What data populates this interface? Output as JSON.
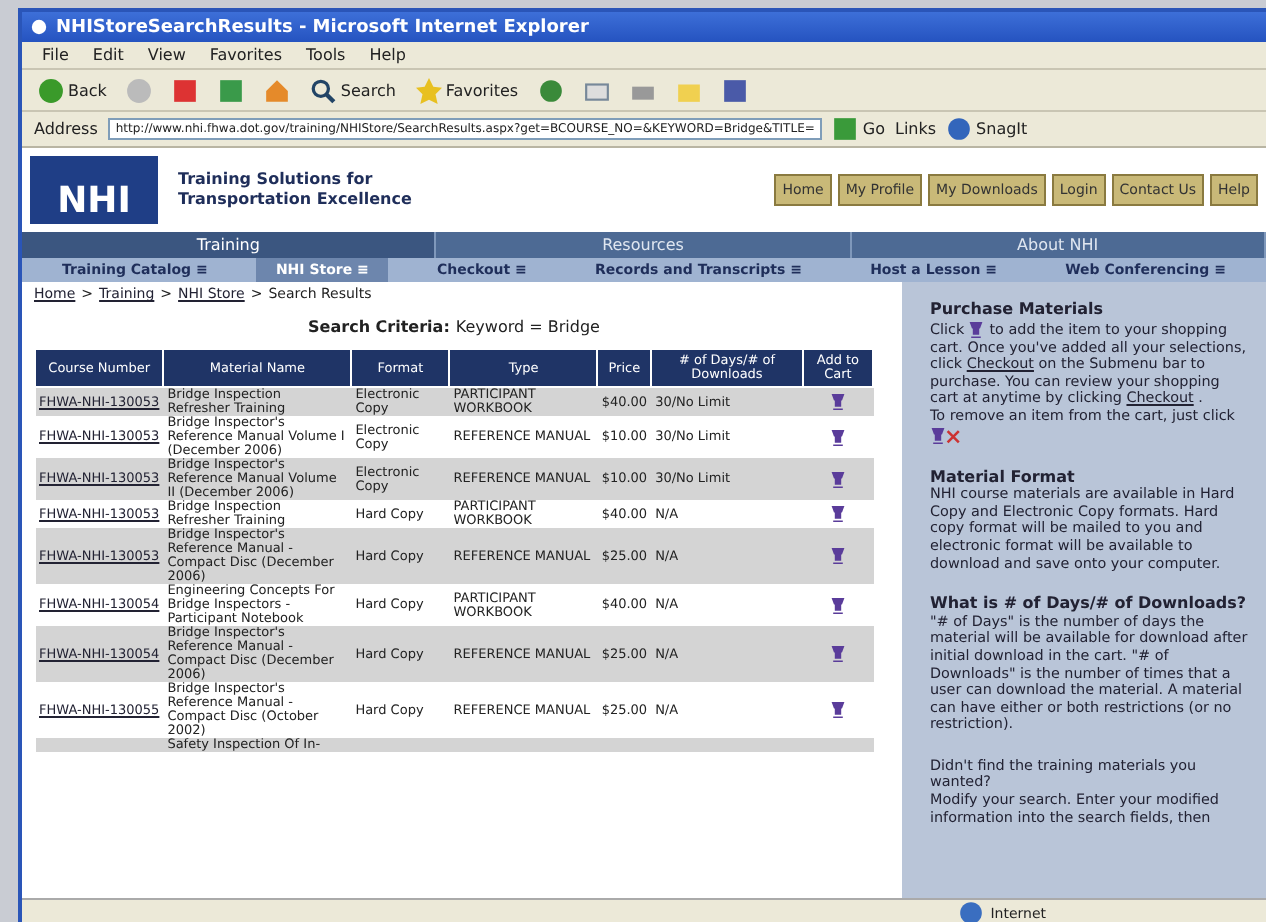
{
  "window": {
    "title": "NHIStoreSearchResults - Microsoft Internet Explorer"
  },
  "menu": [
    "File",
    "Edit",
    "View",
    "Favorites",
    "Tools",
    "Help"
  ],
  "toolbar": {
    "back": "Back",
    "search": "Search",
    "favorites": "Favorites"
  },
  "address_bar": {
    "label": "Address",
    "value": "http://www.nhi.fhwa.dot.gov/training/NHIStore/SearchResults.aspx?get=BCOURSE_NO=&KEYWORD=Bridge&TITLE=",
    "go": "Go",
    "links": "Links",
    "snagit": "SnagIt"
  },
  "site_header": {
    "tagline_1": "Training Solutions for",
    "tagline_2": "Transportation Excellence",
    "logo": "NHI",
    "buttons": [
      "Home",
      "My Profile",
      "My Downloads",
      "Login",
      "Contact Us",
      "Help"
    ]
  },
  "main_tabs": [
    {
      "label": "Training",
      "selected": true
    },
    {
      "label": "Resources",
      "selected": false
    },
    {
      "label": "About NHI",
      "selected": false
    }
  ],
  "sub_tabs": [
    {
      "label": "Training Catalog ≡",
      "selected": false
    },
    {
      "label": "NHI Store ≡",
      "selected": true
    },
    {
      "label": "Checkout ≡",
      "selected": false
    },
    {
      "label": "Records and Transcripts ≡",
      "selected": false
    },
    {
      "label": "Host a Lesson ≡",
      "selected": false
    },
    {
      "label": "Web Conferencing ≡",
      "selected": false
    }
  ],
  "breadcrumb": [
    {
      "label": "Home",
      "kind": "link"
    },
    {
      "label": ">",
      "kind": "separator"
    },
    {
      "label": "Training",
      "kind": "link"
    },
    {
      "label": ">",
      "kind": "separator"
    },
    {
      "label": "NHI Store",
      "kind": "link"
    },
    {
      "label": ">",
      "kind": "separator"
    },
    {
      "label": "Search Results",
      "kind": "current"
    }
  ],
  "search_criteria": {
    "label": "Search Criteria:",
    "value": "Keyword = Bridge"
  },
  "table": {
    "columns": [
      "Course Number",
      "Material Name",
      "Format",
      "Type",
      "Price",
      "# of Days/# of Downloads",
      "Add to Cart"
    ],
    "rows": [
      {
        "course": "FHWA-NHI-130053",
        "material": "Bridge Inspection Refresher Training",
        "format": "Electronic Copy",
        "type": "PARTICIPANT WORKBOOK",
        "price": "$40.00",
        "limit": "30/No Limit"
      },
      {
        "course": "FHWA-NHI-130053",
        "material": "Bridge Inspector's Reference Manual Volume I (December 2006)",
        "format": "Electronic Copy",
        "type": "REFERENCE MANUAL",
        "price": "$10.00",
        "limit": "30/No Limit"
      },
      {
        "course": "FHWA-NHI-130053",
        "material": "Bridge Inspector's Reference Manual Volume II (December 2006)",
        "format": "Electronic Copy",
        "type": "REFERENCE MANUAL",
        "price": "$10.00",
        "limit": "30/No Limit"
      },
      {
        "course": "FHWA-NHI-130053",
        "material": "Bridge Inspection Refresher Training",
        "format": "Hard Copy",
        "type": "PARTICIPANT WORKBOOK",
        "price": "$40.00",
        "limit": "N/A"
      },
      {
        "course": "FHWA-NHI-130053",
        "material": "Bridge Inspector's Reference Manual - Compact Disc (December 2006)",
        "format": "Hard Copy",
        "type": "REFERENCE MANUAL",
        "price": "$25.00",
        "limit": "N/A"
      },
      {
        "course": "FHWA-NHI-130054",
        "material": "Engineering Concepts For Bridge Inspectors - Participant Notebook",
        "format": "Hard Copy",
        "type": "PARTICIPANT WORKBOOK",
        "price": "$40.00",
        "limit": "N/A"
      },
      {
        "course": "FHWA-NHI-130054",
        "material": "Bridge Inspector's Reference Manual - Compact Disc (December 2006)",
        "format": "Hard Copy",
        "type": "REFERENCE MANUAL",
        "price": "$25.00",
        "limit": "N/A"
      },
      {
        "course": "FHWA-NHI-130055",
        "material": "Bridge Inspector's Reference Manual - Compact Disc (October 2002)",
        "format": "Hard Copy",
        "type": "REFERENCE MANUAL",
        "price": "$25.00",
        "limit": "N/A"
      },
      {
        "material": "Safety Inspection Of In-"
      }
    ]
  },
  "sidebar": {
    "sections": [
      {
        "heading": "Purchase Materials",
        "paragraphs": [
          [
            {
              "kind": "text",
              "text": "Click"
            },
            {
              "kind": "cart"
            },
            {
              "kind": "text",
              "text": "to add the item to your shopping cart. Once you've added all your selections, click"
            },
            {
              "kind": "link",
              "text": "Checkout"
            },
            {
              "kind": "text",
              "text": "on the Submenu bar to purchase. You can review your shopping cart at anytime by clicking"
            },
            {
              "kind": "link",
              "text": "Checkout"
            },
            {
              "kind": "text",
              "text": "."
            }
          ],
          [
            {
              "kind": "text",
              "text": "To remove an item from the cart, just click"
            },
            {
              "kind": "remove"
            }
          ]
        ]
      },
      {
        "heading": "Material Format",
        "paragraphs": [
          [
            {
              "kind": "text",
              "text": "NHI course materials are available in Hard Copy and Electronic Copy formats. Hard copy format will be mailed to you and electronic format will be available to download and save onto your computer."
            }
          ]
        ]
      },
      {
        "heading": "What is # of Days/# of Downloads?",
        "paragraphs": [
          [
            {
              "kind": "text",
              "text": "\"# of Days\" is the number of days the material will be available for download after initial download in the cart. \"# of Downloads\" is the number of times that a user can download the material. A material can have either or both restrictions (or no restriction)."
            }
          ]
        ]
      },
      {
        "paragraphs": [
          [
            {
              "kind": "text",
              "text": "Didn't find the training materials you wanted?"
            }
          ],
          [
            {
              "kind": "text",
              "text": "Modify your search. Enter your modified information into the search fields, then"
            }
          ]
        ]
      }
    ]
  },
  "status_bar": {
    "zone": "Internet"
  }
}
